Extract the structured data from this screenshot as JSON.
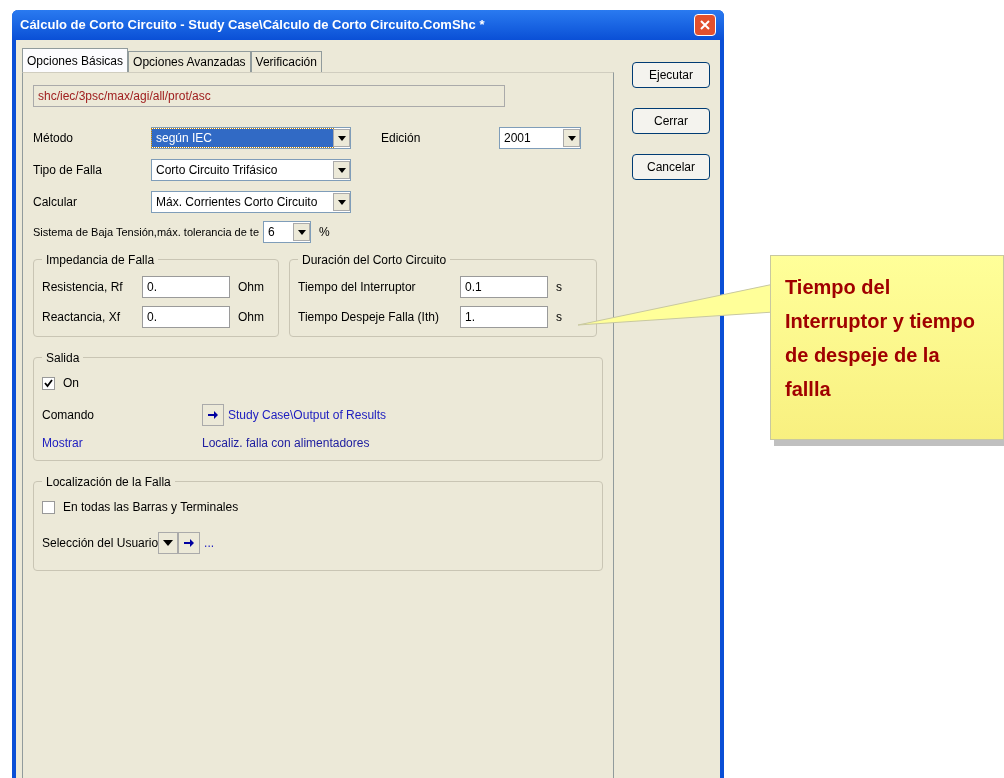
{
  "window": {
    "title": "Cálculo de Corto Circuito - Study Case\\Cálculo de Corto Circuito.ComShc *"
  },
  "tabs": [
    {
      "label": "Opciones Básicas",
      "selected": true
    },
    {
      "label": "Opciones Avanzadas",
      "selected": false
    },
    {
      "label": "Verificación",
      "selected": false
    }
  ],
  "buttons": [
    "Ejecutar",
    "Cerrar",
    "Cancelar"
  ],
  "command_path": "shc/iec/3psc/max/agi/all/prot/asc",
  "settings": [
    {
      "label": "Método",
      "value": "según IEC",
      "selected": true
    },
    {
      "label": "Tipo de Falla",
      "value": "Corto Circuito Trifásico",
      "selected": false
    },
    {
      "label": "Calcular",
      "value": "Máx. Corrientes Corto Circuito",
      "selected": false
    }
  ],
  "edition": {
    "label": "Edición",
    "value": "2001"
  },
  "tolerance": {
    "label": "Sistema de Baja Tensión,máx. tolerancia de te",
    "value": "6",
    "unit": "%"
  },
  "impedance": {
    "title": "Impedancia de Falla",
    "fields": [
      {
        "label": "Resistencia, Rf",
        "value": "0.",
        "unit": "Ohm"
      },
      {
        "label": "Reactancia, Xf",
        "value": "0.",
        "unit": "Ohm"
      }
    ]
  },
  "duration": {
    "title": "Duración del Corto Circuito",
    "fields": [
      {
        "label": "Tiempo del Interruptor",
        "value": "0.1",
        "unit": "s"
      },
      {
        "label": "Tiempo Despeje Falla (Ith)",
        "value": "1.",
        "unit": "s"
      }
    ]
  },
  "output": {
    "title": "Salida",
    "checkbox": {
      "label": "On",
      "checked": true
    },
    "command_label": "Comando",
    "command_link": "Study Case\\Output of Results",
    "show_label": "Mostrar",
    "show_value": "Localiz. falla con alimentadores"
  },
  "fault_location": {
    "title": "Localización de la Falla",
    "checkbox": {
      "label": "En todas las Barras y Terminales",
      "checked": false
    },
    "user_selection": "Selección del Usuario",
    "ellipsis": "..."
  },
  "callout": {
    "text": "Tiempo del Interruptor y tiempo de despeje de la fallla"
  }
}
